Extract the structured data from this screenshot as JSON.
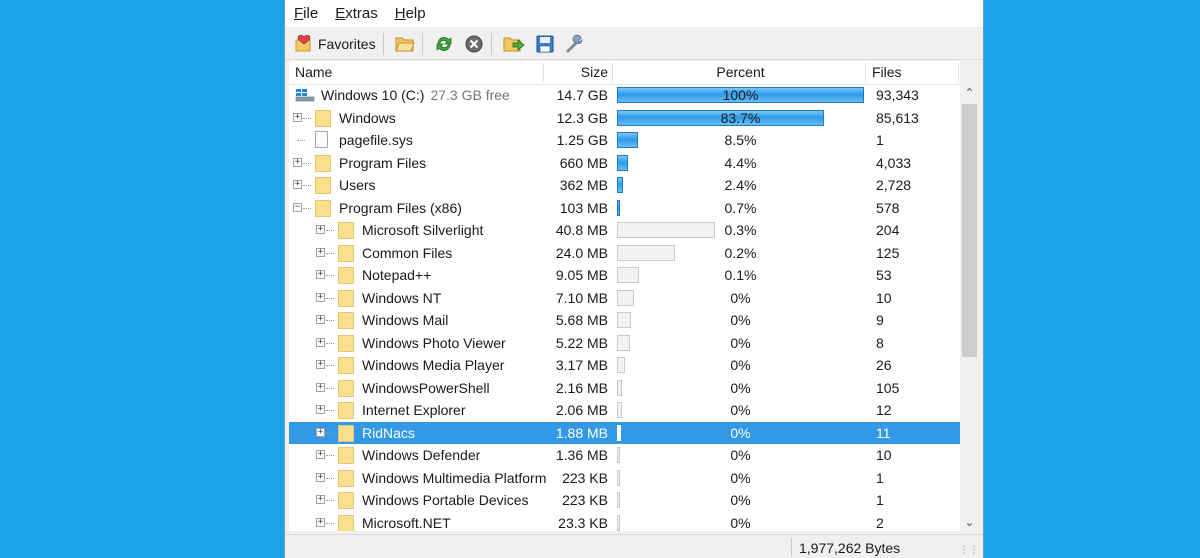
{
  "menu": [
    {
      "label": "File",
      "accel": "F",
      "rest": "ile"
    },
    {
      "label": "Extras",
      "accel": "E",
      "rest": "xtras"
    },
    {
      "label": "Help",
      "accel": "H",
      "rest": "elp"
    }
  ],
  "toolbar": {
    "favorites_label": "Favorites",
    "icons": [
      "favorites-icon",
      "open-folder-icon",
      "refresh-icon",
      "stop-icon",
      "export-icon",
      "save-icon",
      "settings-icon"
    ]
  },
  "columns": {
    "name": "Name",
    "size": "Size",
    "percent": "Percent",
    "files": "Files"
  },
  "drive": {
    "name": "Windows 10 (C:)",
    "free": "27.3 GB free",
    "size": "14.7 GB",
    "percent": "100%",
    "percent_value": 100,
    "files": "93,343"
  },
  "rows": [
    {
      "name": "Windows",
      "size": "12.3 GB",
      "percent": "83.7%",
      "bar_percent": 83.7,
      "files": "85,613",
      "level": 1,
      "type": "folder",
      "expander": "+"
    },
    {
      "name": "pagefile.sys",
      "size": "1.25 GB",
      "percent": "8.5%",
      "bar_percent": 8.5,
      "files": "1",
      "level": 1,
      "type": "file",
      "expander": ""
    },
    {
      "name": "Program Files",
      "size": "660 MB",
      "percent": "4.4%",
      "bar_percent": 4.4,
      "files": "4,033",
      "level": 1,
      "type": "folder",
      "expander": "+"
    },
    {
      "name": "Users",
      "size": "362 MB",
      "percent": "2.4%",
      "bar_percent": 2.4,
      "files": "2,728",
      "level": 1,
      "type": "folder",
      "expander": "+"
    },
    {
      "name": "Program Files (x86)",
      "size": "103 MB",
      "percent": "0.7%",
      "bar_percent": 0.7,
      "files": "578",
      "level": 1,
      "type": "folder",
      "expander": "−"
    },
    {
      "name": "Microsoft Silverlight",
      "size": "40.8 MB",
      "percent": "0.3%",
      "bar_percent": 39.6,
      "files": "204",
      "level": 2,
      "type": "folder",
      "expander": "+"
    },
    {
      "name": "Common Files",
      "size": "24.0 MB",
      "percent": "0.2%",
      "bar_percent": 23.3,
      "files": "125",
      "level": 2,
      "type": "folder",
      "expander": "+"
    },
    {
      "name": "Notepad++",
      "size": "9.05 MB",
      "percent": "0.1%",
      "bar_percent": 8.8,
      "files": "53",
      "level": 2,
      "type": "folder",
      "expander": "+"
    },
    {
      "name": "Windows NT",
      "size": "7.10 MB",
      "percent": "0%",
      "bar_percent": 6.9,
      "files": "10",
      "level": 2,
      "type": "folder",
      "expander": "+"
    },
    {
      "name": "Windows Mail",
      "size": "5.68 MB",
      "percent": "0%",
      "bar_percent": 5.5,
      "files": "9",
      "level": 2,
      "type": "folder",
      "expander": "+"
    },
    {
      "name": "Windows Photo Viewer",
      "size": "5.22 MB",
      "percent": "0%",
      "bar_percent": 5.1,
      "files": "8",
      "level": 2,
      "type": "folder",
      "expander": "+"
    },
    {
      "name": "Windows Media Player",
      "size": "3.17 MB",
      "percent": "0%",
      "bar_percent": 3.1,
      "files": "26",
      "level": 2,
      "type": "folder",
      "expander": "+"
    },
    {
      "name": "WindowsPowerShell",
      "size": "2.16 MB",
      "percent": "0%",
      "bar_percent": 2.1,
      "files": "105",
      "level": 2,
      "type": "folder",
      "expander": "+"
    },
    {
      "name": "Internet Explorer",
      "size": "2.06 MB",
      "percent": "0%",
      "bar_percent": 2.0,
      "files": "12",
      "level": 2,
      "type": "folder",
      "expander": "+"
    },
    {
      "name": "RidNacs",
      "size": "1.88 MB",
      "percent": "0%",
      "bar_percent": 1.8,
      "files": "11",
      "level": 2,
      "type": "folder",
      "expander": "+",
      "selected": true
    },
    {
      "name": "Windows Defender",
      "size": "1.36 MB",
      "percent": "0%",
      "bar_percent": 1.3,
      "files": "10",
      "level": 2,
      "type": "folder",
      "expander": "+"
    },
    {
      "name": "Windows Multimedia Platform",
      "size": "223 KB",
      "percent": "0%",
      "bar_percent": 0.2,
      "files": "1",
      "level": 2,
      "type": "folder",
      "expander": "+"
    },
    {
      "name": "Windows Portable Devices",
      "size": "223 KB",
      "percent": "0%",
      "bar_percent": 0.2,
      "files": "1",
      "level": 2,
      "type": "folder",
      "expander": "+"
    },
    {
      "name": "Microsoft.NET",
      "size": "23.3 KB",
      "percent": "0%",
      "bar_percent": 0.0,
      "files": "2",
      "level": 2,
      "type": "folder",
      "expander": "+"
    }
  ],
  "status": {
    "bytes": "1,977,262 Bytes"
  },
  "colors": {
    "background": "#1aa3e6",
    "selection": "#3399e6",
    "bar_blue": "#2e9be8",
    "folder": "#fbdf8e"
  }
}
